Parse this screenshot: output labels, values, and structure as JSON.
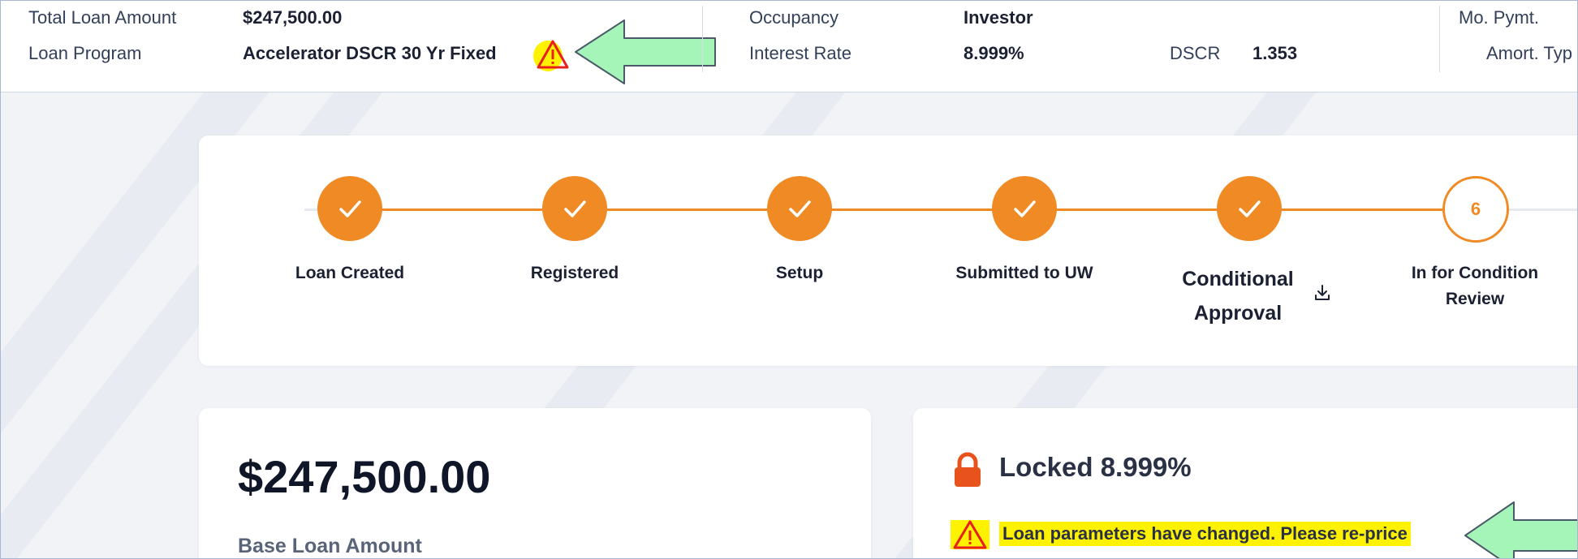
{
  "summary": {
    "total_loan_amount_label": "Total Loan Amount",
    "total_loan_amount_value": "$247,500.00",
    "loan_program_label": "Loan Program",
    "loan_program_value": "Accelerator DSCR 30 Yr Fixed",
    "occupancy_label": "Occupancy",
    "occupancy_value": "Investor",
    "interest_rate_label": "Interest Rate",
    "interest_rate_value": "8.999%",
    "dscr_label": "DSCR",
    "dscr_value": "1.353",
    "mo_pymt_label": "Mo. Pymt.",
    "amort_type_label": "Amort. Typ"
  },
  "stepper": {
    "steps": [
      {
        "label": "Loan Created",
        "state": "done"
      },
      {
        "label": "Registered",
        "state": "done"
      },
      {
        "label": "Setup",
        "state": "done"
      },
      {
        "label": "Submitted to UW",
        "state": "done"
      },
      {
        "label": "Conditional Approval",
        "state": "done"
      },
      {
        "label": "In for Condition Review",
        "state": "current",
        "number": "6"
      }
    ]
  },
  "amount_card": {
    "amount": "$247,500.00",
    "label": "Base Loan Amount"
  },
  "lock_card": {
    "title": "Locked 8.999%",
    "warning": "Loan parameters have changed. Please re-price"
  },
  "colors": {
    "accent": "#f08a24",
    "lock": "#e8521c",
    "highlight": "#fff200",
    "warning_icon": "#e8201c",
    "annotation_arrow": "#a6f5b8"
  }
}
